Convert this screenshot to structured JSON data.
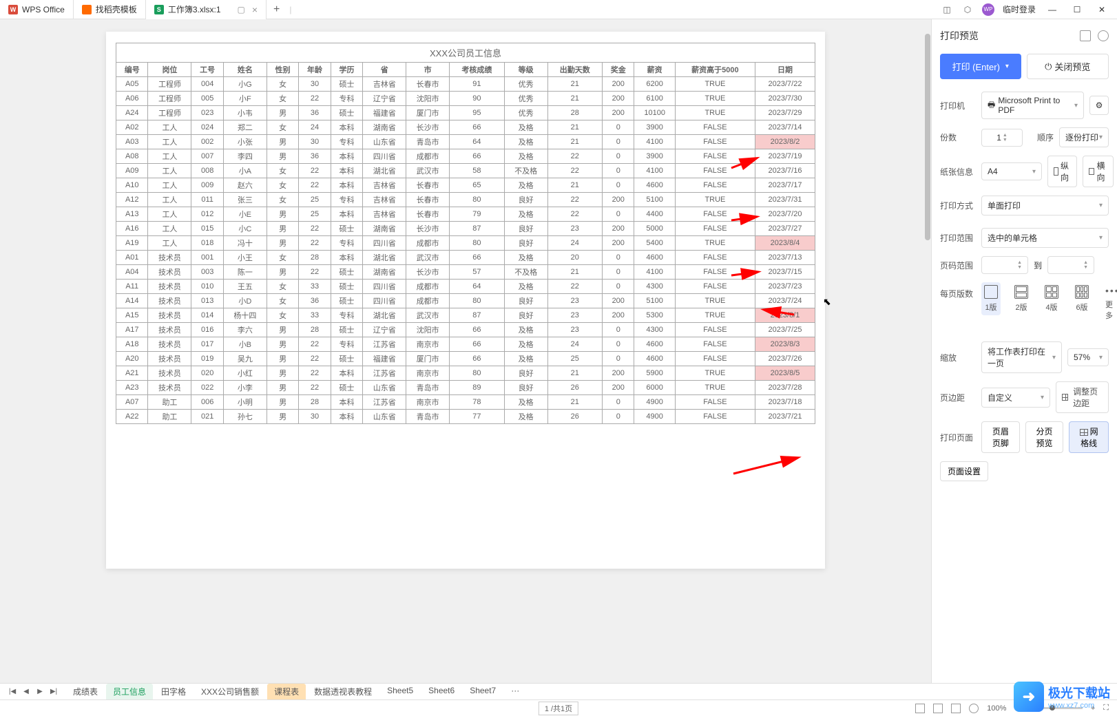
{
  "titlebar": {
    "tabs": [
      {
        "label": "WPS Office",
        "icon": "wps"
      },
      {
        "label": "找稻壳模板",
        "icon": "docer"
      },
      {
        "label": "工作簿3.xlsx:1",
        "icon": "xlsx",
        "active": true
      }
    ],
    "login": "临时登录"
  },
  "page": {
    "title": "XXX公司员工信息",
    "headers": [
      "编号",
      "岗位",
      "工号",
      "姓名",
      "性别",
      "年龄",
      "学历",
      "省",
      "市",
      "考核成绩",
      "等级",
      "出勤天数",
      "奖金",
      "薪资",
      "薪资高于5000",
      "日期"
    ],
    "rows": [
      [
        "A05",
        "工程师",
        "004",
        "小G",
        "女",
        "30",
        "硕士",
        "吉林省",
        "长春市",
        "91",
        "优秀",
        "21",
        "200",
        "6200",
        "TRUE",
        "2023/7/22"
      ],
      [
        "A06",
        "工程师",
        "005",
        "小F",
        "女",
        "22",
        "专科",
        "辽宁省",
        "沈阳市",
        "90",
        "优秀",
        "21",
        "200",
        "6100",
        "TRUE",
        "2023/7/30"
      ],
      [
        "A24",
        "工程师",
        "023",
        "小韦",
        "男",
        "36",
        "硕士",
        "福建省",
        "厦门市",
        "95",
        "优秀",
        "28",
        "200",
        "10100",
        "TRUE",
        "2023/7/29"
      ],
      [
        "A02",
        "工人",
        "024",
        "郑二",
        "女",
        "24",
        "本科",
        "湖南省",
        "长沙市",
        "66",
        "及格",
        "21",
        "0",
        "3900",
        "FALSE",
        "2023/7/14"
      ],
      [
        "A03",
        "工人",
        "002",
        "小张",
        "男",
        "30",
        "专科",
        "山东省",
        "青岛市",
        "64",
        "及格",
        "21",
        "0",
        "4100",
        "FALSE",
        "2023/8/2",
        "hl"
      ],
      [
        "A08",
        "工人",
        "007",
        "李四",
        "男",
        "36",
        "本科",
        "四川省",
        "成都市",
        "66",
        "及格",
        "22",
        "0",
        "3900",
        "FALSE",
        "2023/7/19"
      ],
      [
        "A09",
        "工人",
        "008",
        "小A",
        "女",
        "22",
        "本科",
        "湖北省",
        "武汉市",
        "58",
        "不及格",
        "22",
        "0",
        "4100",
        "FALSE",
        "2023/7/16"
      ],
      [
        "A10",
        "工人",
        "009",
        "赵六",
        "女",
        "22",
        "本科",
        "吉林省",
        "长春市",
        "65",
        "及格",
        "21",
        "0",
        "4600",
        "FALSE",
        "2023/7/17"
      ],
      [
        "A12",
        "工人",
        "011",
        "张三",
        "女",
        "25",
        "专科",
        "吉林省",
        "长春市",
        "80",
        "良好",
        "22",
        "200",
        "5100",
        "TRUE",
        "2023/7/31"
      ],
      [
        "A13",
        "工人",
        "012",
        "小E",
        "男",
        "25",
        "本科",
        "吉林省",
        "长春市",
        "79",
        "及格",
        "22",
        "0",
        "4400",
        "FALSE",
        "2023/7/20"
      ],
      [
        "A16",
        "工人",
        "015",
        "小C",
        "男",
        "22",
        "硕士",
        "湖南省",
        "长沙市",
        "87",
        "良好",
        "23",
        "200",
        "5000",
        "FALSE",
        "2023/7/27"
      ],
      [
        "A19",
        "工人",
        "018",
        "冯十",
        "男",
        "22",
        "专科",
        "四川省",
        "成都市",
        "80",
        "良好",
        "24",
        "200",
        "5400",
        "TRUE",
        "2023/8/4",
        "hl"
      ],
      [
        "A01",
        "技术员",
        "001",
        "小王",
        "女",
        "28",
        "本科",
        "湖北省",
        "武汉市",
        "66",
        "及格",
        "20",
        "0",
        "4600",
        "FALSE",
        "2023/7/13"
      ],
      [
        "A04",
        "技术员",
        "003",
        "陈一",
        "男",
        "22",
        "硕士",
        "湖南省",
        "长沙市",
        "57",
        "不及格",
        "21",
        "0",
        "4100",
        "FALSE",
        "2023/7/15"
      ],
      [
        "A11",
        "技术员",
        "010",
        "王五",
        "女",
        "33",
        "硕士",
        "四川省",
        "成都市",
        "64",
        "及格",
        "22",
        "0",
        "4300",
        "FALSE",
        "2023/7/23"
      ],
      [
        "A14",
        "技术员",
        "013",
        "小D",
        "女",
        "36",
        "硕士",
        "四川省",
        "成都市",
        "80",
        "良好",
        "23",
        "200",
        "5100",
        "TRUE",
        "2023/7/24"
      ],
      [
        "A15",
        "技术员",
        "014",
        "杨十四",
        "女",
        "33",
        "专科",
        "湖北省",
        "武汉市",
        "87",
        "良好",
        "23",
        "200",
        "5300",
        "TRUE",
        "2023/8/1",
        "hl"
      ],
      [
        "A17",
        "技术员",
        "016",
        "李六",
        "男",
        "28",
        "硕士",
        "辽宁省",
        "沈阳市",
        "66",
        "及格",
        "23",
        "0",
        "4300",
        "FALSE",
        "2023/7/25"
      ],
      [
        "A18",
        "技术员",
        "017",
        "小B",
        "男",
        "22",
        "专科",
        "江苏省",
        "南京市",
        "66",
        "及格",
        "24",
        "0",
        "4600",
        "FALSE",
        "2023/8/3",
        "hl"
      ],
      [
        "A20",
        "技术员",
        "019",
        "吴九",
        "男",
        "22",
        "硕士",
        "福建省",
        "厦门市",
        "66",
        "及格",
        "25",
        "0",
        "4600",
        "FALSE",
        "2023/7/26"
      ],
      [
        "A21",
        "技术员",
        "020",
        "小红",
        "男",
        "22",
        "本科",
        "江苏省",
        "南京市",
        "80",
        "良好",
        "21",
        "200",
        "5900",
        "TRUE",
        "2023/8/5",
        "hl"
      ],
      [
        "A23",
        "技术员",
        "022",
        "小李",
        "男",
        "22",
        "硕士",
        "山东省",
        "青岛市",
        "89",
        "良好",
        "26",
        "200",
        "6000",
        "TRUE",
        "2023/7/28"
      ],
      [
        "A07",
        "助工",
        "006",
        "小明",
        "男",
        "28",
        "本科",
        "江苏省",
        "南京市",
        "78",
        "及格",
        "21",
        "0",
        "4900",
        "FALSE",
        "2023/7/18"
      ],
      [
        "A22",
        "助工",
        "021",
        "孙七",
        "男",
        "30",
        "本科",
        "山东省",
        "青岛市",
        "77",
        "及格",
        "26",
        "0",
        "4900",
        "FALSE",
        "2023/7/21"
      ]
    ]
  },
  "panel": {
    "title": "打印预览",
    "print_btn": "打印 (Enter)",
    "close_btn": "关闭预览",
    "printer_label": "打印机",
    "printer_value": "Microsoft Print to PDF",
    "copies_label": "份数",
    "copies_value": "1",
    "order_label": "顺序",
    "order_value": "逐份打印",
    "paper_label": "纸张信息",
    "paper_value": "A4",
    "portrait": "纵向",
    "landscape": "横向",
    "print_method_label": "打印方式",
    "print_method_value": "单面打印",
    "print_range_label": "打印范围",
    "print_range_value": "选中的单元格",
    "page_range_label": "页码范围",
    "page_to": "到",
    "per_page_label": "每页版数",
    "layouts": [
      "1版",
      "2版",
      "4版",
      "6版",
      "更多"
    ],
    "scale_label": "缩放",
    "scale_value": "将工作表打印在一页",
    "scale_percent": "57%",
    "margin_label": "页边距",
    "margin_value": "自定义",
    "adjust_margin": "调整页边距",
    "print_page_label": "打印页面",
    "header_footer": "页眉页脚",
    "page_break_preview": "分页预览",
    "gridlines": "网格线",
    "page_setup": "页面设置"
  },
  "sheets": {
    "tabs": [
      "成绩表",
      "员工信息",
      "田字格",
      "XXX公司销售额",
      "课程表",
      "数据透视表教程",
      "Sheet5",
      "Sheet6",
      "Sheet7",
      "···"
    ],
    "active": "员工信息",
    "orange": "课程表"
  },
  "statusbar": {
    "page_info": "1 /共1页",
    "zoom": "100%"
  },
  "watermark": {
    "name": "极光下载站",
    "url": "www.xz7.com"
  }
}
